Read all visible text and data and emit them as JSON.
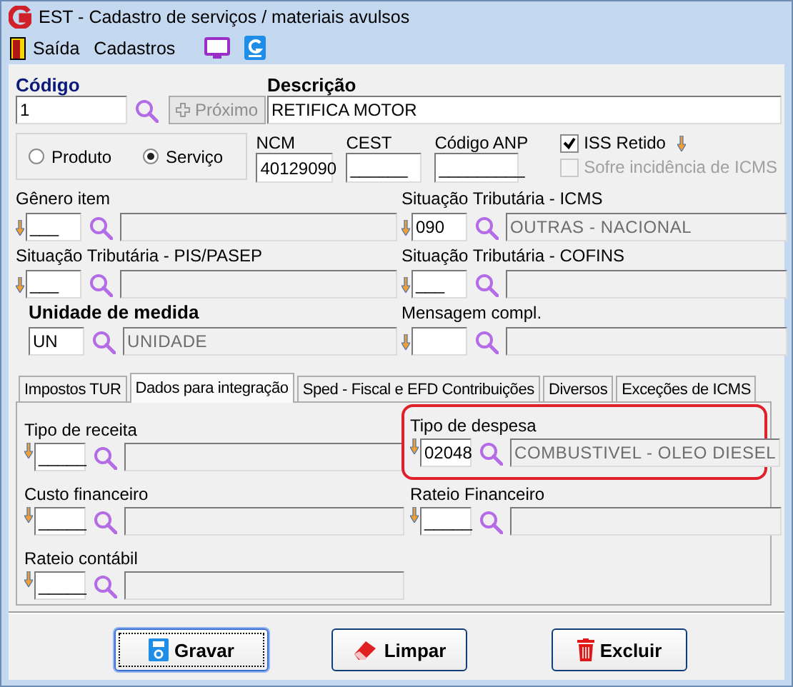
{
  "window": {
    "title": "EST - Cadastro de serviços / materiais avulsos"
  },
  "menu": [
    {
      "kind": "exit",
      "label": "Saída"
    },
    {
      "kind": "text",
      "label": "Cadastros"
    },
    {
      "kind": "monitor"
    },
    {
      "kind": "logo"
    }
  ],
  "codigo": {
    "label": "Código",
    "value": "1"
  },
  "next_button": {
    "label": "Próximo",
    "disabled": true
  },
  "descricao": {
    "label": "Descrição",
    "value": "RETIFICA MOTOR"
  },
  "type_options": [
    {
      "label": "Produto",
      "selected": false
    },
    {
      "label": "Serviço",
      "selected": true
    }
  ],
  "codes": [
    {
      "label": "NCM",
      "value": "40129090"
    },
    {
      "label": "CEST",
      "value": "______"
    },
    {
      "label": "Código ANP",
      "value": "_________"
    }
  ],
  "checkboxes": [
    {
      "label": "ISS Retido",
      "checked": true,
      "disabled": false,
      "arrow": true
    },
    {
      "label": "Sofre incidência de ICMS",
      "checked": false,
      "disabled": true,
      "arrow": false
    }
  ],
  "lookups": [
    {
      "label": "Gênero item",
      "code": "___",
      "arrow": true,
      "bold": false
    },
    {
      "label": "Situação Tributária - ICMS",
      "code": "090",
      "description": "OUTRAS - NACIONAL",
      "arrow": true,
      "bold": false
    },
    {
      "label": "Situação Tributária - PIS/PASEP",
      "code": "___",
      "arrow": true,
      "bold": false
    },
    {
      "label": "Situação Tributária - COFINS",
      "code": "___",
      "arrow": true,
      "bold": false
    },
    {
      "label": "Unidade de medida",
      "code": "UN",
      "description": "UNIDADE",
      "arrow": false,
      "bold": true
    },
    {
      "label": "Mensagem compl.",
      "arrow": true,
      "bold": false
    }
  ],
  "tabs": [
    {
      "label": "Impostos TUR",
      "selected": false
    },
    {
      "label": "Dados para integração",
      "selected": true
    },
    {
      "label": "Sped - Fiscal e EFD Contribuições",
      "selected": false
    },
    {
      "label": "Diversos",
      "selected": false
    },
    {
      "label": "Exceções de ICMS",
      "selected": false
    }
  ],
  "tab_lookups": [
    {
      "label": "Tipo de receita",
      "code": "_____",
      "arrow": true,
      "highlighted": false
    },
    {
      "label": "Tipo de despesa",
      "code": "02048",
      "description": "COMBUSTIVEL - OLEO DIESEL",
      "arrow": true,
      "highlighted": true
    },
    {
      "label": "Custo financeiro",
      "code": "_____",
      "arrow": true,
      "highlighted": false
    },
    {
      "label": "Rateio Financeiro",
      "code": "_____",
      "arrow": true,
      "highlighted": false
    },
    {
      "label": "Rateio contábil",
      "code": "_____",
      "arrow": true,
      "highlighted": false
    }
  ],
  "buttons": [
    {
      "kind": "save",
      "label": "Gravar",
      "focused": true
    },
    {
      "kind": "clear",
      "label": "Limpar",
      "focused": false
    },
    {
      "kind": "delete",
      "label": "Excluir",
      "focused": false
    }
  ]
}
